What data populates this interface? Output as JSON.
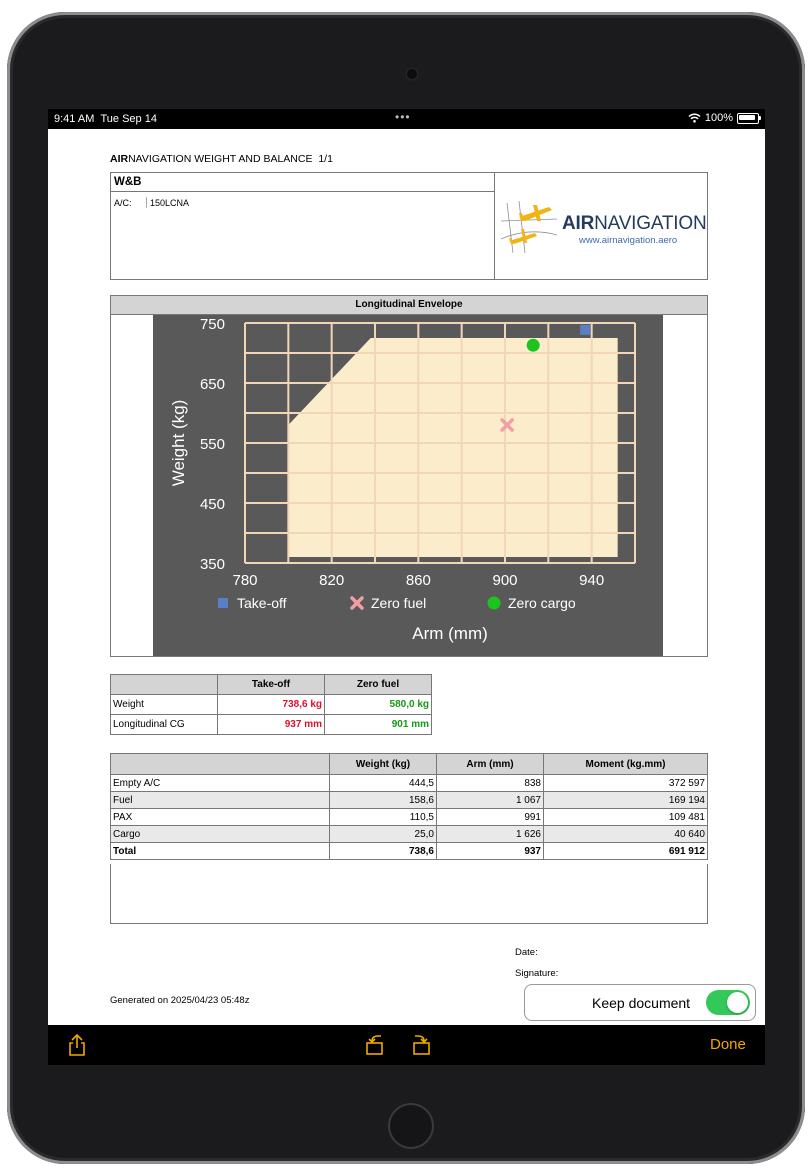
{
  "status_bar": {
    "time": "9:41 AM",
    "date": "Tue Sep 14",
    "battery": "100%"
  },
  "document": {
    "title_bold": "AIR",
    "title_rest": "NAVIGATION WEIGHT AND BALANCE",
    "page": "1/1",
    "section_title": "W&B",
    "ac_label": "A/C:",
    "ac_value": "150LCNA",
    "logo_bold": "AIR",
    "logo_rest": "NAVIGATION",
    "logo_url": "www.airnavigation.aero"
  },
  "envelope": {
    "title": "Longitudinal Envelope",
    "legend": [
      "Take-off",
      "Zero fuel",
      "Zero cargo"
    ]
  },
  "chart_data": {
    "type": "scatter",
    "title": "Longitudinal Envelope",
    "xlabel": "Arm (mm)",
    "ylabel": "Weight (kg)",
    "xlim": [
      780,
      960
    ],
    "ylim": [
      350,
      750
    ],
    "x_ticks": [
      780,
      820,
      860,
      900,
      940
    ],
    "y_ticks": [
      350,
      450,
      550,
      650,
      750
    ],
    "grid": true,
    "envelope_polygon": [
      [
        800,
        360
      ],
      [
        800,
        580
      ],
      [
        838,
        725
      ],
      [
        952,
        725
      ],
      [
        952,
        360
      ]
    ],
    "series": [
      {
        "name": "Take-off",
        "marker": "square",
        "color": "#5a7fc4",
        "x": [
          937
        ],
        "y": [
          738.6
        ]
      },
      {
        "name": "Zero fuel",
        "marker": "x",
        "color": "#f0a0a4",
        "x": [
          901
        ],
        "y": [
          580
        ]
      },
      {
        "name": "Zero cargo",
        "marker": "circle",
        "color": "#1ec41e",
        "x": [
          913
        ],
        "y": [
          713
        ]
      }
    ],
    "colors": {
      "background": "#595959",
      "envelope_fill": "#fbeccc",
      "grid": "#f1d6b8",
      "text": "#ffffff"
    }
  },
  "summary_table": {
    "headers": [
      "",
      "Take-off",
      "Zero fuel"
    ],
    "rows": [
      {
        "label": "Weight",
        "takeoff": "738,6 kg",
        "zerofuel": "580,0 kg"
      },
      {
        "label": "Longitudinal CG",
        "takeoff": "937 mm",
        "zerofuel": "901 mm"
      }
    ]
  },
  "moment_table": {
    "headers": [
      "",
      "Weight (kg)",
      "Arm (mm)",
      "Moment (kg.mm)"
    ],
    "rows": [
      [
        "Empty A/C",
        "444,5",
        "838",
        "372 597"
      ],
      [
        "Fuel",
        "158,6",
        "1 067",
        "169 194"
      ],
      [
        "PAX",
        "110,5",
        "991",
        "109 481"
      ],
      [
        "Cargo",
        "25,0",
        "1 626",
        "40 640"
      ]
    ],
    "total": [
      "Total",
      "738,6",
      "937",
      "691 912"
    ]
  },
  "footer": {
    "date_label": "Date:",
    "signature_label": "Signature:",
    "generated": "Generated on 2025/04/23 05:48z"
  },
  "keep_document": {
    "label": "Keep document",
    "on": true
  },
  "toolbar": {
    "done_label": "Done",
    "icons": [
      "share-icon",
      "rotate-left-icon",
      "rotate-right-icon"
    ]
  }
}
